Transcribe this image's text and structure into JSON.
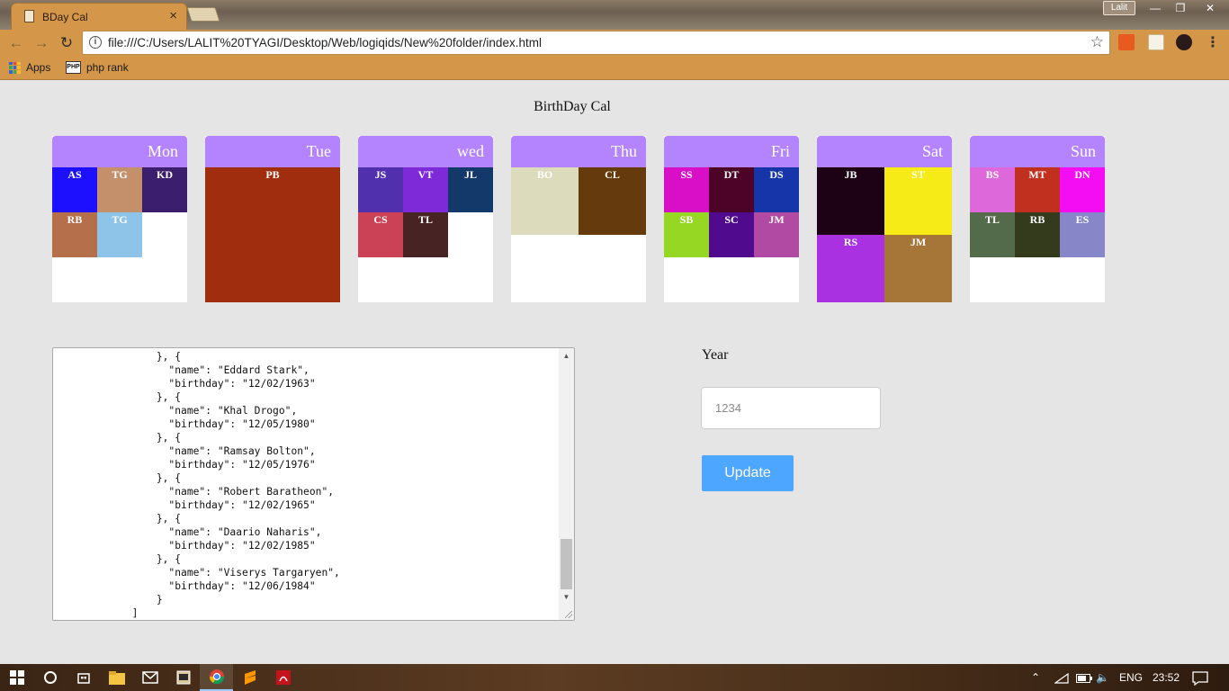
{
  "browser": {
    "tab_title": "BDay Cal",
    "tab_close": "×",
    "profile_name": "Lalit",
    "url": "file:///C:/Users/LALIT%20TYAGI/Desktop/Web/logiqids/New%20folder/index.html",
    "bookmarks": [
      {
        "label": "Apps",
        "icon": "apps-grid-icon"
      },
      {
        "label": "php rank",
        "icon": "php-icon"
      }
    ]
  },
  "page": {
    "title": "BirthDay Cal"
  },
  "days": [
    {
      "label": "Mon",
      "size": 50,
      "cells": [
        {
          "initials": "AS",
          "color": "#1d10ff"
        },
        {
          "initials": "TG",
          "color": "#c4906b"
        },
        {
          "initials": "KD",
          "color": "#3b1f6e"
        },
        {
          "initials": "RB",
          "color": "#b56f4b"
        },
        {
          "initials": "TG",
          "color": "#8ec4e8"
        }
      ]
    },
    {
      "label": "Tue",
      "size": 150,
      "cells": [
        {
          "initials": "PB",
          "color": "#a02d0e"
        }
      ]
    },
    {
      "label": "wed",
      "size": 50,
      "cells": [
        {
          "initials": "JS",
          "color": "#5130ad"
        },
        {
          "initials": "VT",
          "color": "#7f2ad8"
        },
        {
          "initials": "JL",
          "color": "#13386a"
        },
        {
          "initials": "CS",
          "color": "#cb4257"
        },
        {
          "initials": "TL",
          "color": "#472423"
        }
      ]
    },
    {
      "label": "Thu",
      "size": 75,
      "cells": [
        {
          "initials": "BO",
          "color": "#dcdcbd"
        },
        {
          "initials": "CL",
          "color": "#653a0c"
        }
      ]
    },
    {
      "label": "Fri",
      "size": 50,
      "cells": [
        {
          "initials": "SS",
          "color": "#d90fc8"
        },
        {
          "initials": "DT",
          "color": "#4d0227"
        },
        {
          "initials": "DS",
          "color": "#1535a9"
        },
        {
          "initials": "SB",
          "color": "#95d723"
        },
        {
          "initials": "SC",
          "color": "#4f0a8e"
        },
        {
          "initials": "JM",
          "color": "#b04aa2"
        }
      ]
    },
    {
      "label": "Sat",
      "size": 75,
      "cells": [
        {
          "initials": "JB",
          "color": "#1c0214"
        },
        {
          "initials": "ST",
          "color": "#f7eb17"
        },
        {
          "initials": "RS",
          "color": "#a931e1"
        },
        {
          "initials": "JM",
          "color": "#a67538"
        }
      ]
    },
    {
      "label": "Sun",
      "size": 50,
      "cells": [
        {
          "initials": "BS",
          "color": "#dd68d9"
        },
        {
          "initials": "MT",
          "color": "#c1301f"
        },
        {
          "initials": "DN",
          "color": "#f40cf3"
        },
        {
          "initials": "TL",
          "color": "#546b4b"
        },
        {
          "initials": "RB",
          "color": "#333b1c"
        },
        {
          "initials": "ES",
          "color": "#8786c9"
        }
      ]
    }
  ],
  "editor": {
    "lines": [
      "                  },",
      "                }, {",
      "                  \"name\": \"Eddard Stark\",",
      "                  \"birthday\": \"12/02/1963\"",
      "                }, {",
      "                  \"name\": \"Khal Drogo\",",
      "                  \"birthday\": \"12/05/1980\"",
      "                }, {",
      "                  \"name\": \"Ramsay Bolton\",",
      "                  \"birthday\": \"12/05/1976\"",
      "                }, {",
      "                  \"name\": \"Robert Baratheon\",",
      "                  \"birthday\": \"12/02/1965\"",
      "                }, {",
      "                  \"name\": \"Daario Naharis\",",
      "                  \"birthday\": \"12/02/1985\"",
      "                }, {",
      "                  \"name\": \"Viserys Targaryen\",",
      "                  \"birthday\": \"12/06/1984\"",
      "                }",
      "            ]"
    ]
  },
  "form": {
    "year_label": "Year",
    "year_placeholder": "1234",
    "update_label": "Update"
  },
  "taskbar": {
    "language": "ENG",
    "time": "23:52"
  }
}
